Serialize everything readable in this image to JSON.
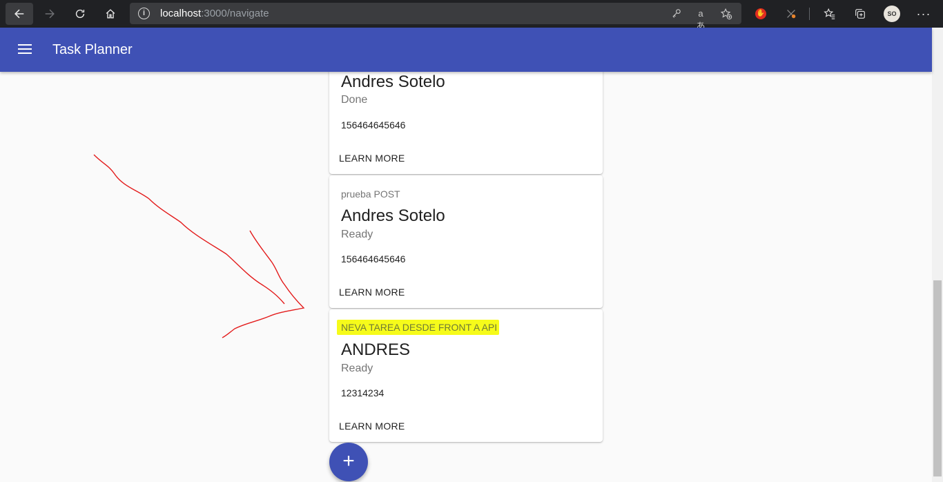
{
  "browser": {
    "url_host": "localhost",
    "url_path": ":3000/navigate",
    "profile_initials": "SO",
    "icons": [
      "back-icon",
      "forward-icon",
      "refresh-icon",
      "home-icon",
      "info-icon",
      "key-icon",
      "read-aloud-icon",
      "add-favorite-icon",
      "adblock-extension-icon",
      "color-extension-icon",
      "favorites-icon",
      "collections-icon",
      "more-icon"
    ]
  },
  "appbar": {
    "title": "Task Planner",
    "color": "#3f51b5"
  },
  "cards": [
    {
      "overline": "",
      "name": "Andres Sotelo",
      "status": "Done",
      "number": "156464645646",
      "action": "LEARN MORE"
    },
    {
      "overline": "prueba POST",
      "name": "Andres Sotelo",
      "status": "Ready",
      "number": "156464645646",
      "action": "LEARN MORE"
    },
    {
      "overline": "NEVA TAREA DESDE FRONT A API",
      "name": "ANDRES",
      "status": "Ready",
      "number": "12314234",
      "action": "LEARN MORE",
      "highlighted": true
    }
  ],
  "fab": {
    "label": "+"
  },
  "annotation": {
    "color": "#e31b1b",
    "highlight_color": "#f6fb1a"
  }
}
